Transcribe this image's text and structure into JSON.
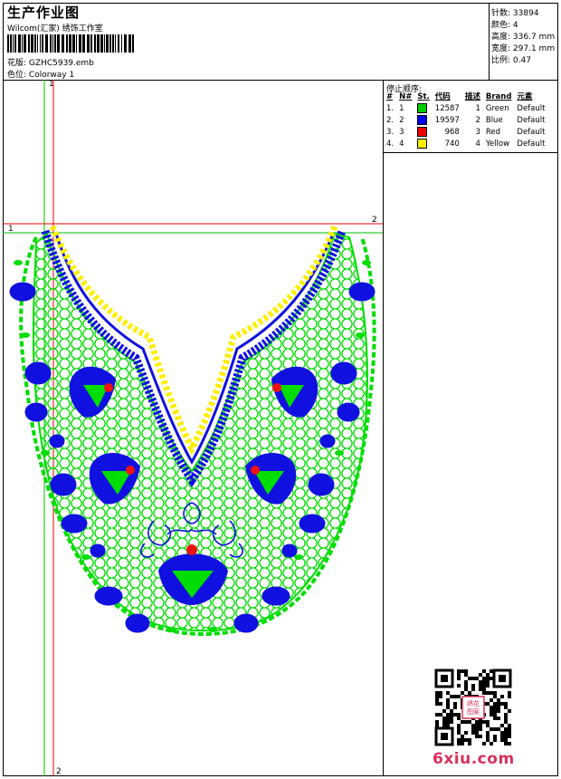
{
  "header": {
    "title": "生产作业图",
    "subtitle": "Wilcom(汇家) 绣饰工作室",
    "pattern_label": "花版:",
    "pattern_value": "GZHC5939.emb",
    "colorway_label": "色位:",
    "colorway_value": "Colorway 1"
  },
  "info": {
    "stitches_label": "针数:",
    "stitches_value": "33894",
    "colors_label": "颜色:",
    "colors_value": "4",
    "height_label": "高度:",
    "height_value": "336.7 mm",
    "width_label": "宽度:",
    "width_value": "297.1 mm",
    "scale_label": "比例:",
    "scale_value": "0.47"
  },
  "stop_sequence": {
    "title": "停止顺序:",
    "columns": [
      "#",
      "N#",
      "St.",
      "代码",
      "描述",
      "Brand",
      "元素"
    ],
    "rows": [
      {
        "index": "1.",
        "n": "1",
        "color": "#00cc00",
        "stitches": "12587",
        "code": "1",
        "desc": "Green",
        "brand": "Default"
      },
      {
        "index": "2.",
        "n": "2",
        "color": "#0000ee",
        "stitches": "19597",
        "code": "2",
        "desc": "Blue",
        "brand": "Default"
      },
      {
        "index": "3.",
        "n": "3",
        "color": "#ee0000",
        "stitches": "968",
        "code": "3",
        "desc": "Red",
        "brand": "Default"
      },
      {
        "index": "4.",
        "n": "4",
        "color": "#ffee00",
        "stitches": "740",
        "code": "4",
        "desc": "Yellow",
        "brand": "Default"
      }
    ]
  },
  "guides": {
    "green_h_label": "1",
    "green_v_label": "1",
    "red_h_label": "2",
    "red_v_label": "2"
  },
  "watermark": {
    "text": "6xiu.com",
    "seal_text": "绣花图案"
  },
  "colors": {
    "green": "#00dd00",
    "blue": "#1010e0",
    "red": "#ee1111",
    "yellow": "#ffee00",
    "guide_green": "#00c000",
    "guide_red": "#ee0000"
  }
}
